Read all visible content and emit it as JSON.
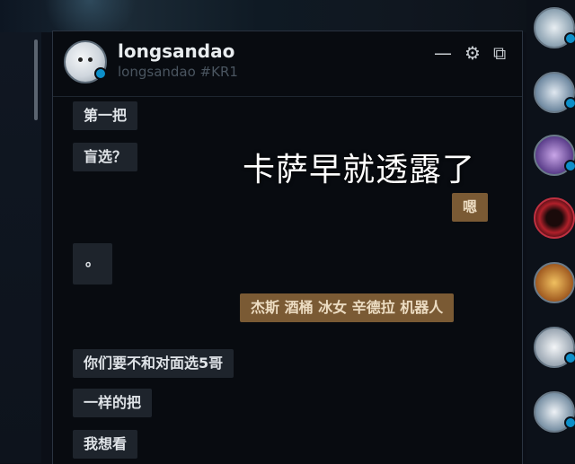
{
  "header": {
    "display_name": "longsandao",
    "riot_tag": "longsandao #KR1",
    "minimize_icon": "—",
    "settings_icon": "⚙",
    "popout_icon": "⧉"
  },
  "messages": [
    {
      "dir": "in",
      "text": "第一把"
    },
    {
      "dir": "in",
      "text": "盲选？"
    },
    {
      "dir": "out",
      "text": "嗯"
    },
    {
      "dir": "in",
      "text": "。"
    },
    {
      "dir": "out",
      "text": "杰斯 酒桶 冰女 辛德拉 机器人"
    },
    {
      "dir": "in",
      "text": "你们要不和对面选5哥"
    },
    {
      "dir": "in",
      "text": "一样的把"
    },
    {
      "dir": "in",
      "text": "我想看"
    }
  ],
  "overlay_caption": "卡萨早就透露了",
  "colors": {
    "incoming_bubble": "#1e242c",
    "outgoing_bubble": "#7a5a34",
    "online_status": "#0d8fc9"
  }
}
